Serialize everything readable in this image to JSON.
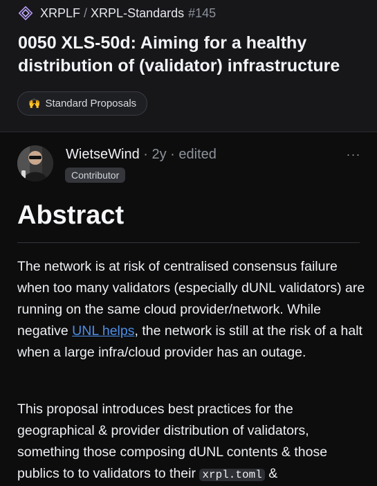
{
  "breadcrumb": {
    "owner": "XRPLF",
    "separator": "/",
    "repo": "XRPL-Standards",
    "number": "#145"
  },
  "title": "0050 XLS-50d: Aiming for a healthy distribution of (validator) infrastructure",
  "category_label": {
    "emoji": "🙌",
    "text": "Standard Proposals"
  },
  "post": {
    "author": "WietseWind",
    "age": " · 2y · edited",
    "role_badge": "Contributor",
    "more_icon": "···"
  },
  "content": {
    "heading": "Abstract",
    "paragraph1_before_link": "The network is at risk of centralised consensus failure when too many validators (especially dUNL validators) are running on the same cloud provider/network. While negative ",
    "paragraph1_link": "UNL helps",
    "paragraph1_after_link": ", the network is still at the risk of a halt when a large infra/cloud provider has an outage.",
    "paragraph2_before_code": "This proposal introduces best practices for the geographical & provider distribution of validators, something those composing dUNL contents & those publics to to validators to their ",
    "paragraph2_code": "xrpl.toml",
    "paragraph2_after_code": " &"
  },
  "colors": {
    "background": "#0d0d0e",
    "header_background": "#17171a",
    "link": "#4d8fe8",
    "muted_text": "#8e939b"
  }
}
